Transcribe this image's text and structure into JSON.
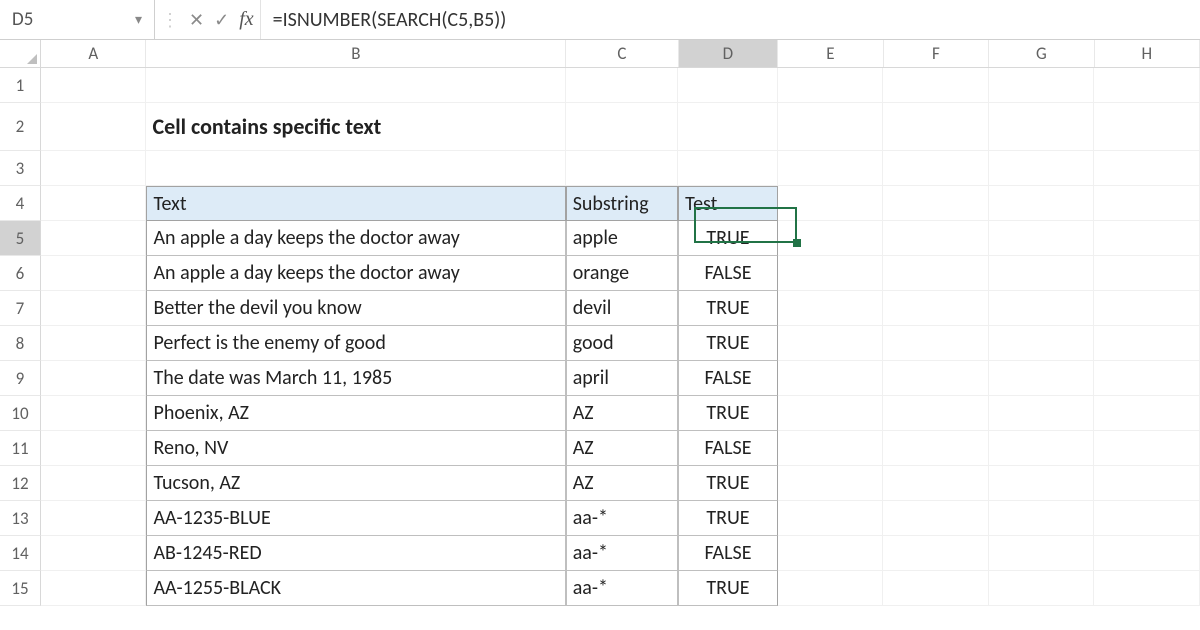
{
  "name_box": "D5",
  "formula": "=ISNUMBER(SEARCH(C5,B5))",
  "icons": {
    "cancel": "✕",
    "enter": "✓",
    "fx": "fx"
  },
  "columns": [
    "A",
    "B",
    "C",
    "D",
    "E",
    "F",
    "G",
    "H"
  ],
  "selected_col": "D",
  "selected_row": "5",
  "row_nums": [
    "1",
    "2",
    "3",
    "4",
    "5",
    "6",
    "7",
    "8",
    "9",
    "10",
    "11",
    "12",
    "13",
    "14",
    "15"
  ],
  "title": "Cell contains specific text",
  "headers": {
    "text": "Text",
    "substring": "Substring",
    "test": "Test"
  },
  "table_rows": [
    {
      "text": "An apple a day keeps the doctor away",
      "sub": "apple",
      "test": "TRUE"
    },
    {
      "text": "An apple a day keeps the doctor away",
      "sub": "orange",
      "test": "FALSE"
    },
    {
      "text": "Better the devil you know",
      "sub": "devil",
      "test": "TRUE"
    },
    {
      "text": "Perfect is the enemy of good",
      "sub": "good",
      "test": "TRUE"
    },
    {
      "text": "The date was March 11, 1985",
      "sub": "april",
      "test": "FALSE"
    },
    {
      "text": "Phoenix, AZ",
      "sub": "AZ",
      "test": "TRUE"
    },
    {
      "text": "Reno, NV",
      "sub": "AZ",
      "test": "FALSE"
    },
    {
      "text": "Tucson, AZ",
      "sub": "AZ",
      "test": "TRUE"
    },
    {
      "text": "AA-1235-BLUE",
      "sub": "aa-*",
      "test": "TRUE"
    },
    {
      "text": "AB-1245-RED",
      "sub": "aa-*",
      "test": "FALSE"
    },
    {
      "text": "AA-1255-BLACK",
      "sub": "aa-*",
      "test": "TRUE"
    }
  ],
  "chart_data": {
    "type": "table",
    "title": "Cell contains specific text",
    "columns": [
      "Text",
      "Substring",
      "Test"
    ],
    "rows": [
      [
        "An apple a day keeps the doctor away",
        "apple",
        "TRUE"
      ],
      [
        "An apple a day keeps the doctor away",
        "orange",
        "FALSE"
      ],
      [
        "Better the devil you know",
        "devil",
        "TRUE"
      ],
      [
        "Perfect is the enemy of good",
        "good",
        "TRUE"
      ],
      [
        "The date was March 11, 1985",
        "april",
        "FALSE"
      ],
      [
        "Phoenix, AZ",
        "AZ",
        "TRUE"
      ],
      [
        "Reno, NV",
        "AZ",
        "FALSE"
      ],
      [
        "Tucson, AZ",
        "AZ",
        "TRUE"
      ],
      [
        "AA-1235-BLUE",
        "aa-*",
        "TRUE"
      ],
      [
        "AB-1245-RED",
        "aa-*",
        "FALSE"
      ],
      [
        "AA-1255-BLACK",
        "aa-*",
        "TRUE"
      ]
    ]
  }
}
